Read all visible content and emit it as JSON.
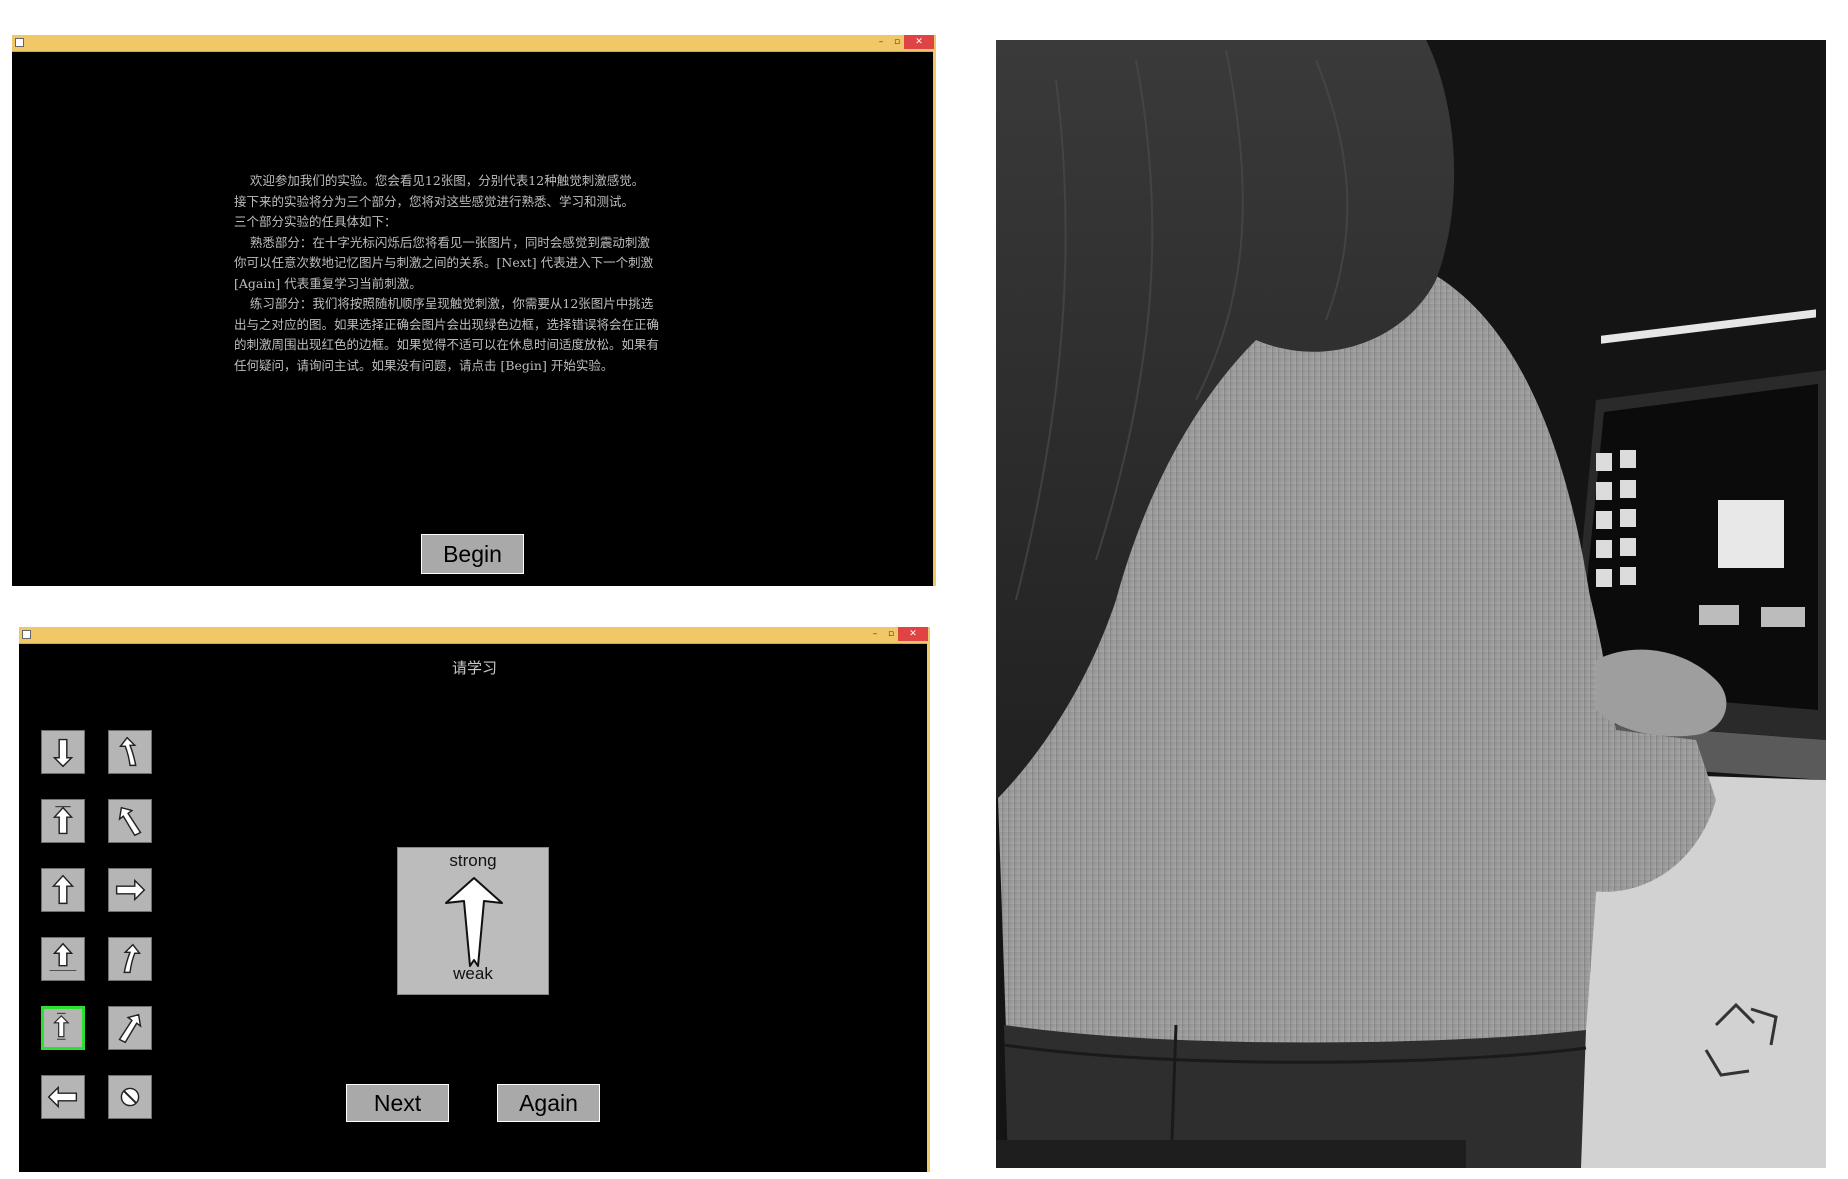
{
  "window1": {
    "intro_lines": [
      "    欢迎参加我们的实验。您会看见12张图，分别代表12种触觉刺激感觉。",
      "接下来的实验将分为三个部分，您将对这些感觉进行熟悉、学习和测试。",
      "三个部分实验的任具体如下：",
      "    熟悉部分：在十字光标闪烁后您将看见一张图片，同时会感觉到震动刺激",
      "你可以任意次数地记忆图片与刺激之间的关系。[Next] 代表进入下一个刺激",
      "[Again] 代表重复学习当前刺激。",
      "    练习部分：我们将按照随机顺序呈现触觉刺激，你需要从12张图片中挑选",
      "出与之对应的图。如果选择正确会图片会出现绿色边框，选择错误将会在正确",
      "的刺激周围出现红色的边框。如果觉得不适可以在休息时间适度放松。如果有",
      "任何疑问，请询问主试。如果没有问题，请点击 [Begin] 开始实验。"
    ],
    "begin_label": "Begin"
  },
  "window2": {
    "heading": "请学习",
    "tiles": [
      {
        "icon": "arrow-down-icon"
      },
      {
        "icon": "curve-arrow-up-left-icon"
      },
      {
        "icon": "arrow-up-strong-icon"
      },
      {
        "icon": "arrow-up-left-icon"
      },
      {
        "icon": "arrow-up-icon"
      },
      {
        "icon": "arrow-right-icon"
      },
      {
        "icon": "arrow-up-high-speed-icon"
      },
      {
        "icon": "curve-arrow-up-right-icon"
      },
      {
        "icon": "arrow-up-strong-weak-icon",
        "selected": true
      },
      {
        "icon": "arrow-up-right-icon"
      },
      {
        "icon": "arrow-left-icon"
      },
      {
        "icon": "no-stimulus-icon"
      }
    ],
    "stimulus": {
      "top_label": "strong",
      "bottom_label": "weak"
    },
    "next_label": "Next",
    "again_label": "Again"
  },
  "colors": {
    "titlebar": "#f0c868",
    "close_button": "#e04343",
    "selected_border": "#2ee02e",
    "button_bg": "#a9a9a9"
  }
}
